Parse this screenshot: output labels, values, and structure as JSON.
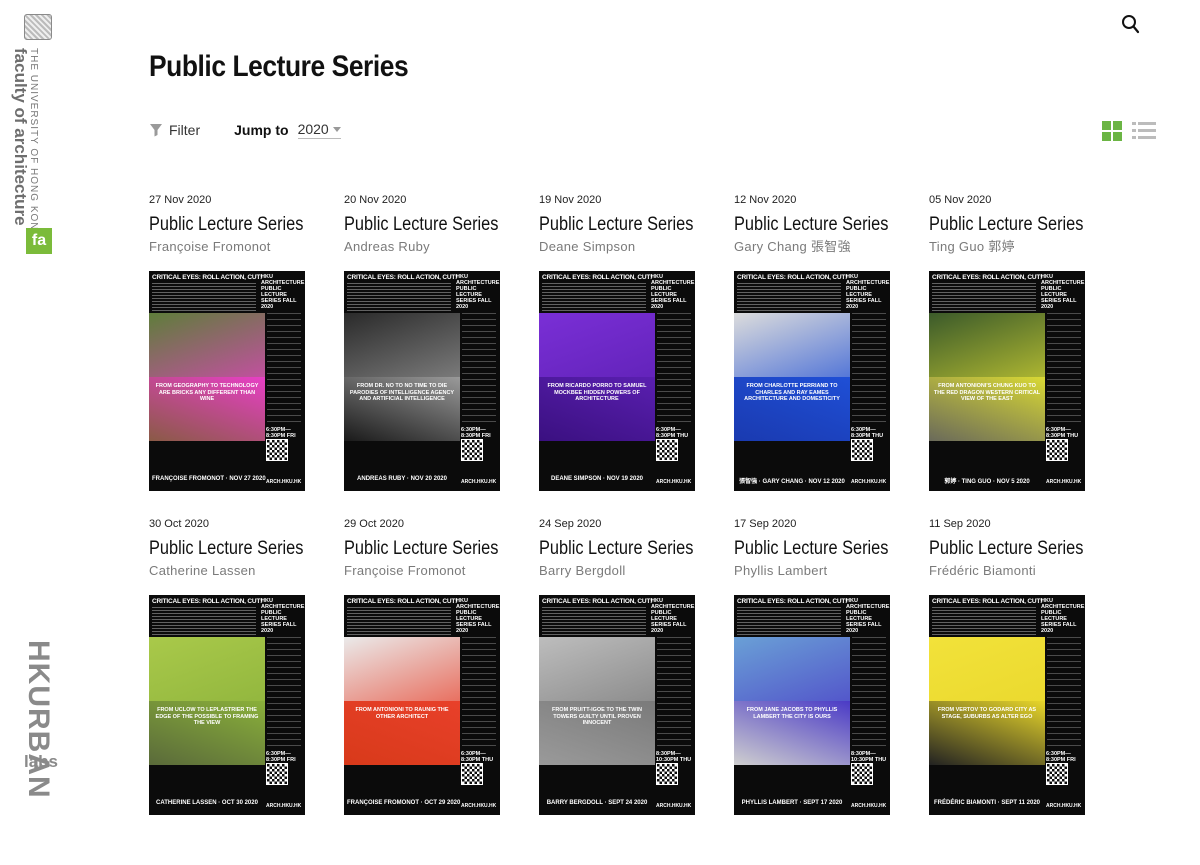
{
  "branding": {
    "university": "THE UNIVERSITY OF HONG KONG",
    "faculty": "faculty of architecture",
    "logo_mark": "fa",
    "urban_main": "HKURBAN",
    "urban_sub": "labs",
    "crest_icon": "hku-crest-icon"
  },
  "header": {
    "title": "Public Lecture Series",
    "search_icon": "search-icon"
  },
  "toolbar": {
    "filter_label": "Filter",
    "jump_label": "Jump to",
    "year_value": "2020",
    "grid_view_active": true,
    "accent_color": "#6bb544"
  },
  "poster_common": {
    "heading": "CRITICAL EYES: ROLL ACTION, CUT!",
    "series": "HKU ARCHITECTURE PUBLIC LECTURE SERIES FALL 2020",
    "mark": "ARCH.HKU.HK"
  },
  "lectures": [
    {
      "date": "27 Nov 2020",
      "title": "Public Lecture Series",
      "speaker": "Françoise Fromonot",
      "poster_text": "FROM GEOGRAPHY TO TECHNOLOGY ARE BRICKS ANY DIFFERENT THAN WINE",
      "poster_foot": "FRANÇOISE FROMONOT · NOV 27 2020",
      "poster_time": "6:30PM—8:30PM FRI 27NOV",
      "palette": {
        "top": "#5e7d3a",
        "mid": "#e83fc6",
        "bottom": "#8a5a46"
      }
    },
    {
      "date": "20 Nov 2020",
      "title": "Public Lecture Series",
      "speaker": "Andreas Ruby",
      "poster_text": "FROM DR. NO TO NO TIME TO DIE PARODIES OF INTELLIGENCE AGENCY AND ARTIFICIAL INTELLIGENCE",
      "poster_foot": "ANDREAS RUBY · NOV 20 2020",
      "poster_time": "6:30PM—8:30PM FRI 20NOV",
      "palette": {
        "top": "#2a2a2a",
        "mid": "#9a9a9a",
        "bottom": "#1a1a1a"
      }
    },
    {
      "date": "19 Nov 2020",
      "title": "Public Lecture Series",
      "speaker": "Deane Simpson",
      "poster_text": "FROM RICARDO PORRO TO SAMUEL MOCKBEE HIDDEN POWERS OF ARCHITECTURE",
      "poster_foot": "DEANE SIMPSON · NOV 19 2020",
      "poster_time": "6:30PM—8:30PM THU 19NOV",
      "palette": {
        "top": "#7a2fd6",
        "mid": "#5a1fb0",
        "bottom": "#3a1080"
      }
    },
    {
      "date": "12 Nov 2020",
      "title": "Public Lecture Series",
      "speaker": "Gary Chang 張智強",
      "poster_text": "FROM CHARLOTTE PERRIAND TO CHARLES AND RAY EAMES ARCHITECTURE AND DOMESTICITY",
      "poster_foot": "張智強 · GARY CHANG · NOV 12 2020",
      "poster_time": "6:30PM—8:30PM THU 12NOV",
      "palette": {
        "top": "#dcdcdc",
        "mid": "#1f4fd6",
        "bottom": "#1a3ab0"
      }
    },
    {
      "date": "05 Nov 2020",
      "title": "Public Lecture Series",
      "speaker": "Ting Guo 郭婷",
      "poster_text": "FROM ANTONIONI'S CHUNG KUO TO THE RED DRAGON WESTERN CRITICAL VIEW OF THE EAST",
      "poster_foot": "郭婷 · TING GUO · NOV 5 2020",
      "poster_time": "6:30PM—8:30PM THU 5NOV",
      "palette": {
        "top": "#3b5a2a",
        "mid": "#d9d934",
        "bottom": "#6a6a5a"
      }
    },
    {
      "date": "30 Oct 2020",
      "title": "Public Lecture Series",
      "speaker": "Catherine Lassen",
      "poster_text": "FROM UCLOW TO LEPLASTRIER THE EDGE OF THE POSSIBLE TO FRAMING THE VIEW",
      "poster_foot": "CATHERINE LASSEN · OCT 30 2020",
      "poster_time": "6:30PM—8:30PM FRI 30OCT",
      "palette": {
        "top": "#a9c94a",
        "mid": "#8ab03a",
        "bottom": "#5a6a3a"
      }
    },
    {
      "date": "29 Oct 2020",
      "title": "Public Lecture Series",
      "speaker": "Françoise Fromonot",
      "poster_text": "FROM ANTONIONI TO RAUNIG THE OTHER ARCHITECT",
      "poster_foot": "FRANÇOISE FROMONOT · OCT 29 2020",
      "poster_time": "6:30PM—8:30PM THU 29OCT",
      "palette": {
        "top": "#eaeaea",
        "mid": "#e8402a",
        "bottom": "#d83a1a"
      }
    },
    {
      "date": "24 Sep 2020",
      "title": "Public Lecture Series",
      "speaker": "Barry Bergdoll",
      "poster_text": "FROM PRUITT-IGOE TO THE TWIN TOWERS GUILTY UNTIL PROVEN INNOCENT",
      "poster_foot": "BARRY BERGDOLL · SEPT 24 2020",
      "poster_time": "8:30PM—10:30PM THU 24SEP",
      "palette": {
        "top": "#bdbdbd",
        "mid": "#7a7a7a",
        "bottom": "#9a9a9a"
      }
    },
    {
      "date": "17 Sep 2020",
      "title": "Public Lecture Series",
      "speaker": "Phyllis Lambert",
      "poster_text": "FROM JANE JACOBS TO PHYLLIS LAMBERT THE CITY IS OURS",
      "poster_foot": "PHYLLIS LAMBERT · SEPT 17 2020",
      "poster_time": "8:30PM—10:30PM THU 17SEP",
      "palette": {
        "top": "#6aa0d6",
        "mid": "#4a3ac6",
        "bottom": "#cfcfcf"
      }
    },
    {
      "date": "11 Sep 2020",
      "title": "Public Lecture Series",
      "speaker": "Frédéric Biamonti",
      "poster_text": "FROM VERTOV TO GODARD CITY AS STAGE, SUBURBS AS ALTER EGO",
      "poster_foot": "FRÉDÉRIC BIAMONTI · SEPT 11 2020",
      "poster_time": "6:30PM—8:30PM FRI 11SEP",
      "palette": {
        "top": "#f2e23a",
        "mid": "#e8d62a",
        "bottom": "#222222"
      }
    }
  ]
}
